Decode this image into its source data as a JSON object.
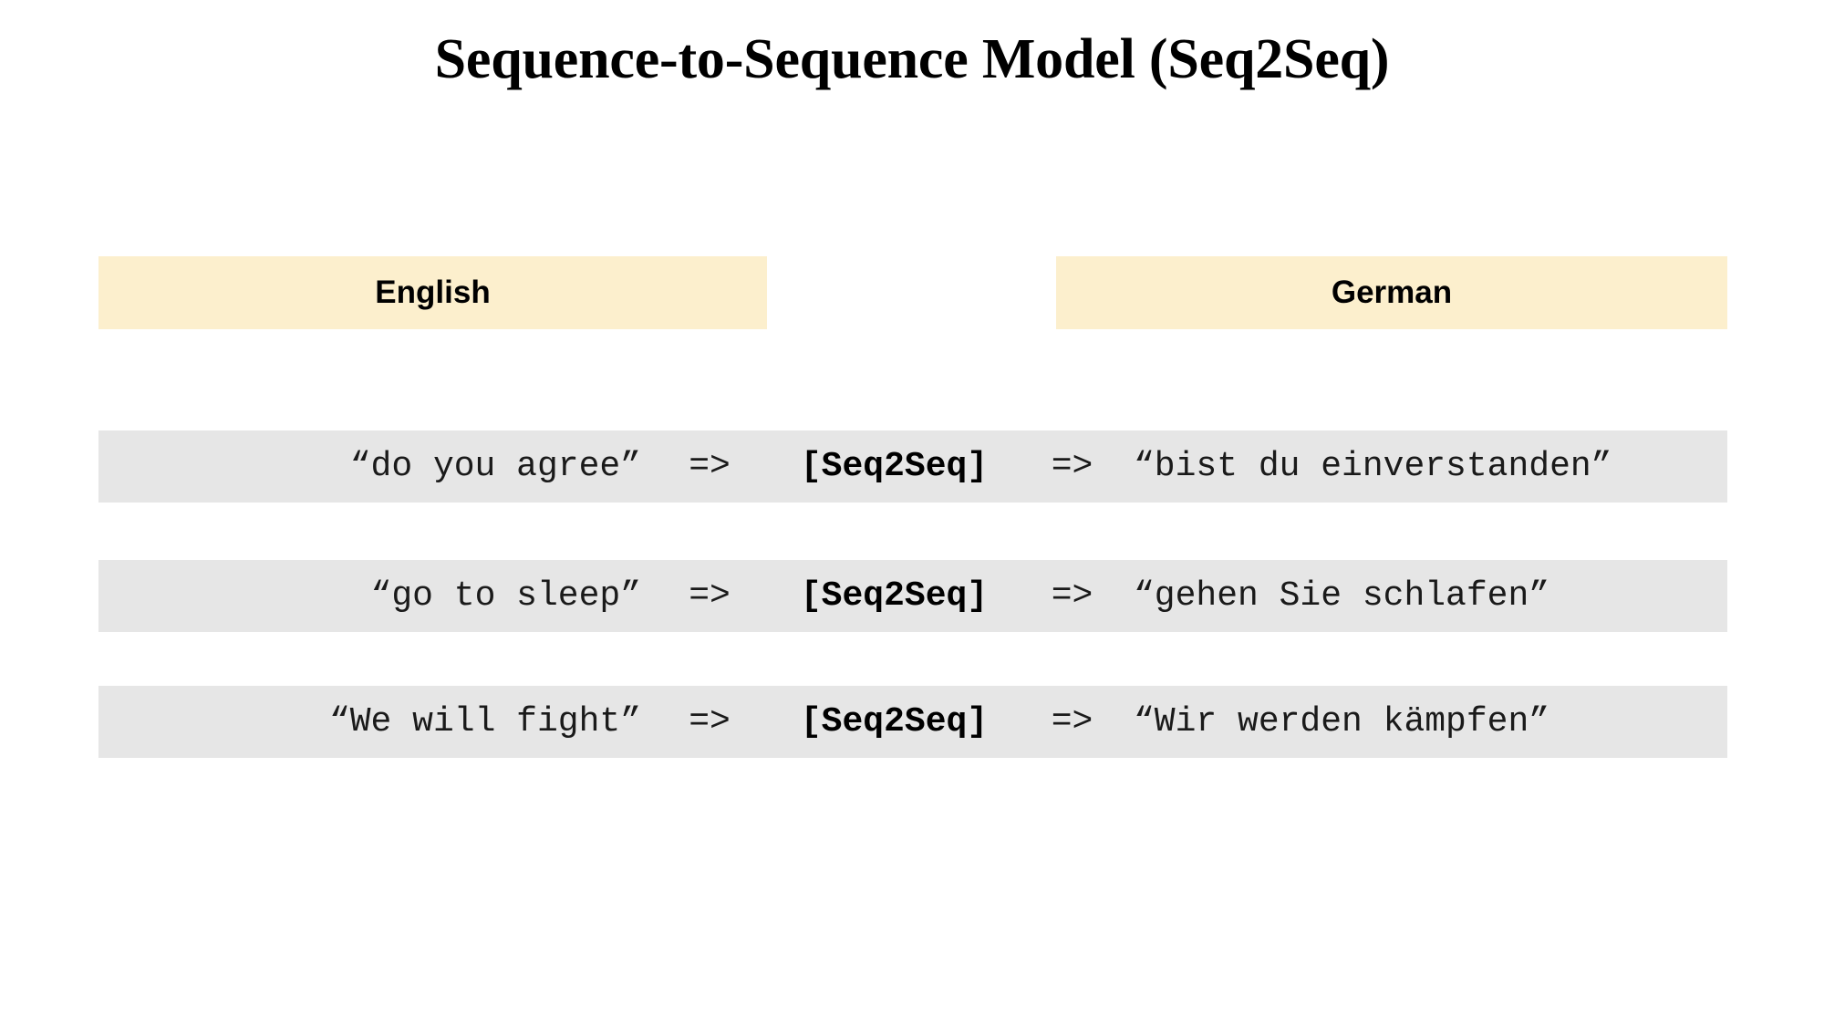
{
  "slide": {
    "title": "Sequence-to-Sequence Model (Seq2Seq)"
  },
  "columns": {
    "source_label": "English",
    "target_label": "German",
    "header_bg": "#fcefcd",
    "row_bg": "#e6e6e6"
  },
  "model": {
    "label": "[Seq2Seq]",
    "arrow": "=>"
  },
  "examples": [
    {
      "source": "“do you agree”",
      "arrow_in": "=>",
      "model": "[Seq2Seq]",
      "arrow_out": "=>",
      "target": "“bist du einverstanden”"
    },
    {
      "source": "“go to sleep”",
      "arrow_in": "=>",
      "model": "[Seq2Seq]",
      "arrow_out": "=>",
      "target": "“gehen Sie schlafen”"
    },
    {
      "source": "“We will fight”",
      "arrow_in": "=>",
      "model": "[Seq2Seq]",
      "arrow_out": "=>",
      "target": "“Wir werden kämpfen”"
    }
  ]
}
